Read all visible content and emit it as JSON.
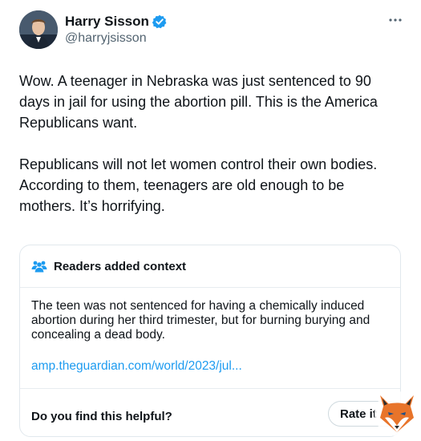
{
  "author": {
    "display_name": "Harry Sisson",
    "handle": "@harryjsisson",
    "verified_badge_color": "#1d9bf0"
  },
  "more_icon": "more-horizontal-icon",
  "tweet": {
    "paragraph_1": "Wow. A teenager in Nebraska was just sentenced to 90 days in jail for using the abortion pill. This is the America Republicans want.",
    "paragraph_2": "Republicans will not let women control their own bodies. According to them, teenagers are old enough to be mothers. It’s horrifying."
  },
  "community_note": {
    "header_icon": "people-icon",
    "title": "Readers added context",
    "body": "The teen was not sentenced for having a chemically induced abortion during her third trimester, but for burning burying and concealing a dead body.",
    "link_text": "amp.theguardian.com/world/2023/jul...",
    "link_color": "#1d9bf0",
    "helpful_question": "Do you find this helpful?",
    "rate_button_label": "Rate it"
  }
}
